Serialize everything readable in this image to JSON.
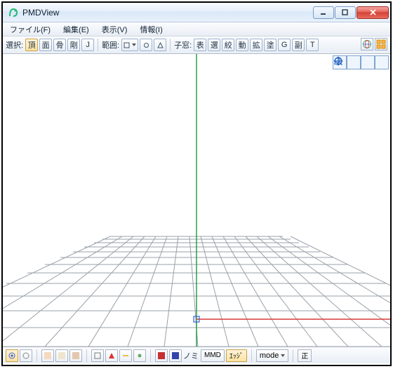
{
  "window": {
    "title": "PMDView"
  },
  "menu": {
    "file": "ファイル(F)",
    "edit": "編集(E)",
    "view": "表示(V)",
    "info": "情報(I)"
  },
  "toolbar": {
    "select_label": "選択:",
    "btn_vertex": "頂",
    "btn_face": "面",
    "btn_bone": "骨",
    "btn_rigid": "剛",
    "btn_joint": "J",
    "range_label": "範囲:",
    "child_label": "子窓:",
    "btn_expr": "表",
    "btn_select": "選",
    "btn_narrow": "絞",
    "btn_move": "動",
    "btn_expand": "拡",
    "btn_paint": "塗",
    "btn_g": "G",
    "btn_sub": "副",
    "btn_t": "T"
  },
  "bottombar": {
    "nomi": "ノミ",
    "mmd": "MMD",
    "edge": "ｴｯｼﾞ",
    "mode": "mode",
    "ortho": "正"
  }
}
